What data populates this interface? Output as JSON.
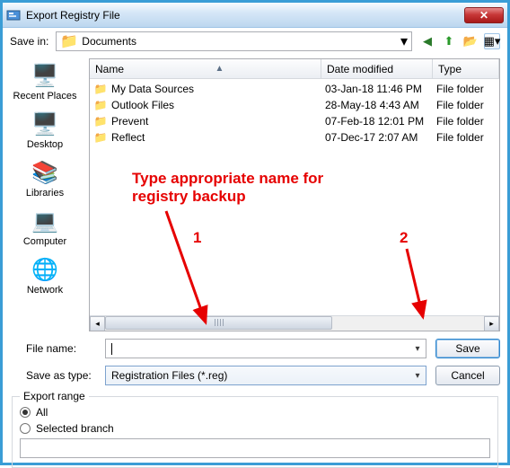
{
  "window": {
    "title": "Export Registry File",
    "close_glyph": "✕"
  },
  "toolbar": {
    "save_in_label": "Save in:",
    "save_in_value": "Documents"
  },
  "sidebar": [
    {
      "name": "recent-places",
      "label": "Recent Places"
    },
    {
      "name": "desktop",
      "label": "Desktop"
    },
    {
      "name": "libraries",
      "label": "Libraries"
    },
    {
      "name": "computer",
      "label": "Computer"
    },
    {
      "name": "network",
      "label": "Network"
    }
  ],
  "columns": {
    "name": "Name",
    "date": "Date modified",
    "type": "Type"
  },
  "files": [
    {
      "name": "My Data Sources",
      "date": "03-Jan-18 11:46 PM",
      "type": "File folder"
    },
    {
      "name": "Outlook Files",
      "date": "28-May-18 4:43 AM",
      "type": "File folder"
    },
    {
      "name": "Prevent",
      "date": "07-Feb-18 12:01 PM",
      "type": "File folder"
    },
    {
      "name": "Reflect",
      "date": "07-Dec-17 2:07 AM",
      "type": "File folder"
    }
  ],
  "form": {
    "file_name_label": "File name:",
    "file_name_value": "",
    "save_as_type_label": "Save as type:",
    "save_as_type_value": "Registration Files (*.reg)",
    "save_button": "Save",
    "cancel_button": "Cancel"
  },
  "export_range": {
    "legend": "Export range",
    "all_label": "All",
    "selected_branch_label": "Selected branch",
    "branch_value": "",
    "selected": "all"
  },
  "annotations": {
    "text": "Type appropriate name for\nregistry backup",
    "label1": "1",
    "label2": "2"
  }
}
